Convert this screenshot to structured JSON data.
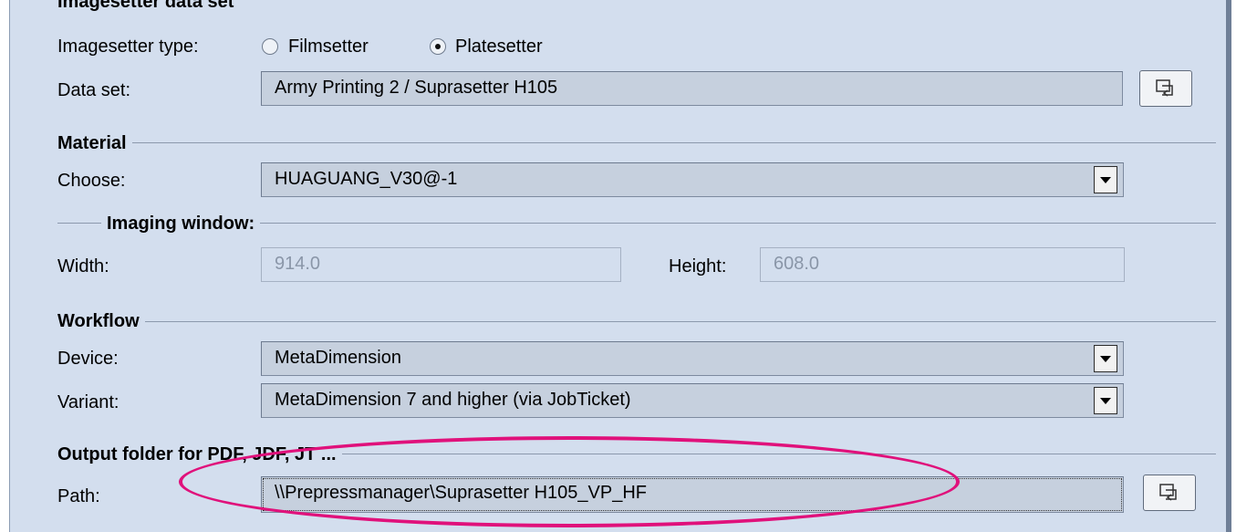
{
  "imagesetter": {
    "section_title": "Imagesetter data set",
    "type_label": "Imagesetter type:",
    "option_filmsetter": "Filmsetter",
    "option_platesetter": "Platesetter",
    "selected": "Platesetter",
    "dataset_label": "Data set:",
    "dataset_value": "Army Printing 2 / Suprasetter H105"
  },
  "material": {
    "section_title": "Material",
    "choose_label": "Choose:",
    "choose_value": "HUAGUANG_V30@-1"
  },
  "imaging_window": {
    "section_title": "Imaging window:",
    "width_label": "Width:",
    "width_value": "914.0",
    "height_label": "Height:",
    "height_value": "608.0"
  },
  "workflow": {
    "section_title": "Workflow",
    "device_label": "Device:",
    "device_value": "MetaDimension",
    "variant_label": "Variant:",
    "variant_value": "MetaDimension 7 and higher (via JobTicket)"
  },
  "output": {
    "section_title": "Output folder for PDF, JDF, JT ...",
    "path_label": "Path:",
    "path_value": "\\\\Prepressmanager\\Suprasetter H105_VP_HF"
  },
  "icons": {
    "browse": "folder-browse-icon",
    "dropdown": "chevron-down-icon"
  },
  "colors": {
    "panel_bg": "#d3deee",
    "highlight": "#e0117b"
  }
}
